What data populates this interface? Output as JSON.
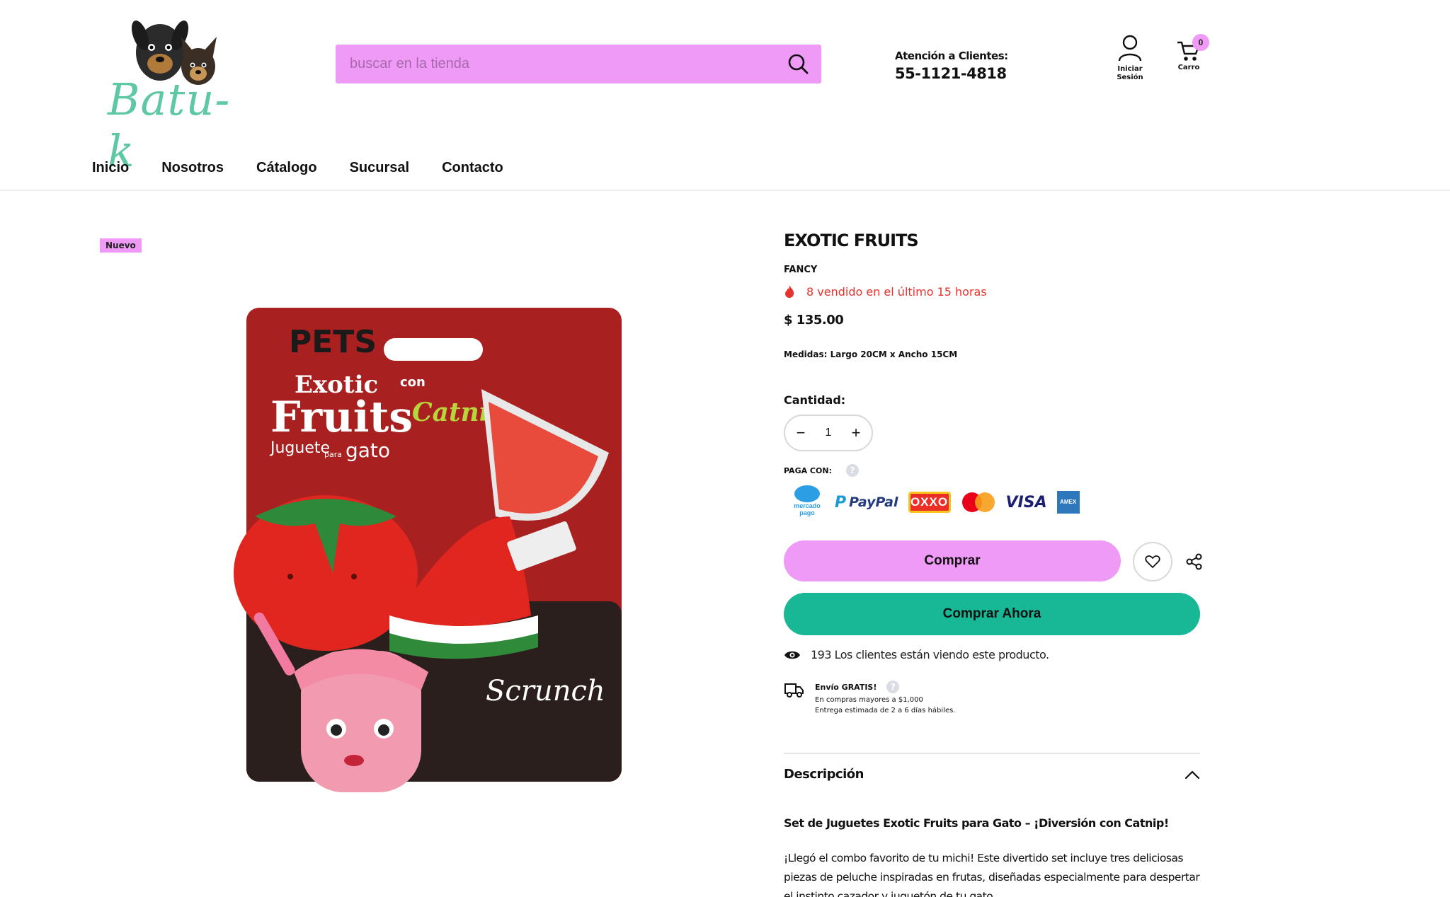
{
  "header": {
    "logo_text": "Batu-k",
    "search": {
      "placeholder": "buscar en la tienda"
    },
    "support": {
      "label": "Atención a Clientes:",
      "phone": "55-1121-4818"
    },
    "account_label": "Iniciar Sesión",
    "cart_label": "Carro",
    "cart_count": "0"
  },
  "nav": {
    "items": [
      {
        "label": "Inicio"
      },
      {
        "label": "Nosotros"
      },
      {
        "label": "Cátalogo"
      },
      {
        "label": "Sucursal"
      },
      {
        "label": "Contacto"
      }
    ]
  },
  "product": {
    "badge": "Nuevo",
    "title": "EXOTIC FRUITS",
    "brand": "FANCY",
    "sold_text": "8 vendido en el último 15 horas",
    "price": "$ 135.00",
    "measures": "Medidas: Largo 20CM x Ancho 15CM",
    "quantity_label": "Cantidad:",
    "quantity_value": "1",
    "pay_with_label": "PAGA CON:",
    "payment_methods": [
      "mercado pago",
      "PayPal",
      "OXXO",
      "Mastercard",
      "VISA",
      "American Express"
    ],
    "buy_label": "Comprar",
    "buy_now_label": "Comprar Ahora",
    "viewers_text": "193 Los clientes están viendo este producto.",
    "shipping": {
      "title": "Envío GRATIS!",
      "line1": "En compras mayores a $1,000",
      "line2": "Entrega estimada de 2 a 6 días hábiles."
    },
    "description": {
      "title": "Descripción",
      "subtitle": "Set de Juguetes Exotic Fruits para Gato – ¡Diversión con Catnip!",
      "body": "¡Llegó el combo favorito de tu michi! Este divertido set incluye tres deliciosas piezas de peluche inspiradas en frutas, diseñadas especialmente para despertar el instinto cazador y juguetón de tu gato."
    }
  },
  "packaging": {
    "brand": "PETS",
    "line1": "Exotic",
    "line2": "Fruits",
    "con": "con",
    "catnip": "Catnip",
    "juguete": "Juguete",
    "para": "para",
    "gato": "gato",
    "scrunch": "Scrunch"
  },
  "colors": {
    "accent_pink": "#ef9af6",
    "accent_teal": "#18b796",
    "alert_red": "#e3332c",
    "logo_green": "#5ec7a3"
  }
}
